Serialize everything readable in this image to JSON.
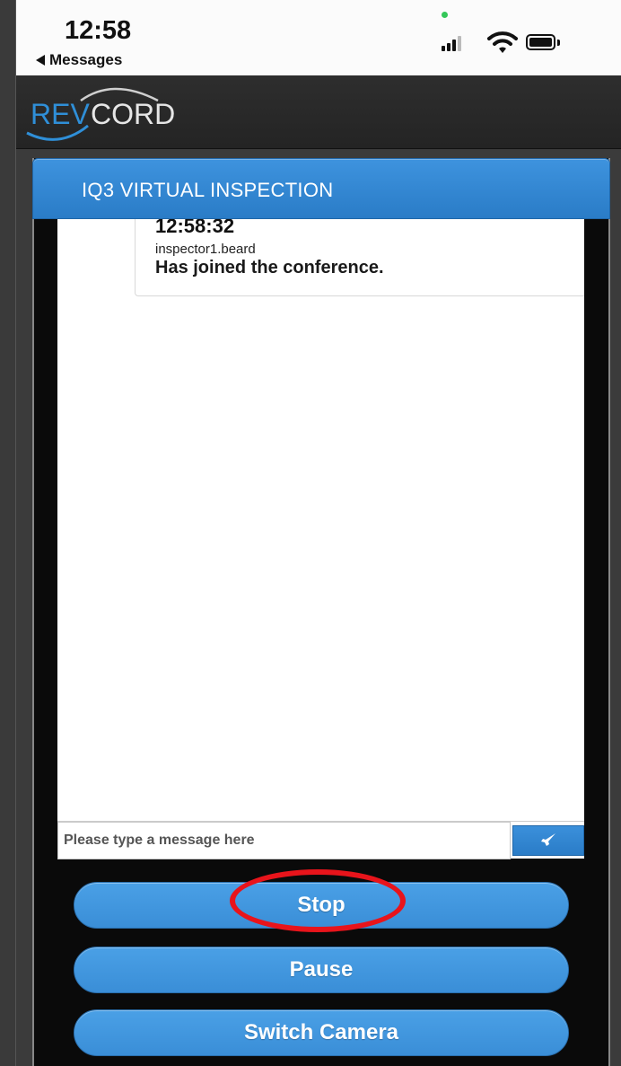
{
  "status_bar": {
    "time": "12:58",
    "back_label": "Messages"
  },
  "header": {
    "logo_text_rev": "REV",
    "logo_text_cord": "CORD"
  },
  "panel": {
    "title": "IQ3 VIRTUAL INSPECTION"
  },
  "chat": {
    "messages": [
      {
        "time": "12:58:32",
        "user": "inspector1.beard",
        "text": "Has joined the conference."
      }
    ],
    "input_placeholder": "Please type a message here"
  },
  "controls": {
    "stop_label": "Stop",
    "pause_label": "Pause",
    "switch_camera_label": "Switch Camera"
  },
  "colors": {
    "accent_blue": "#3a8ed7",
    "annotation_red": "#e8141b",
    "logo_blue": "#2f8fd8"
  }
}
